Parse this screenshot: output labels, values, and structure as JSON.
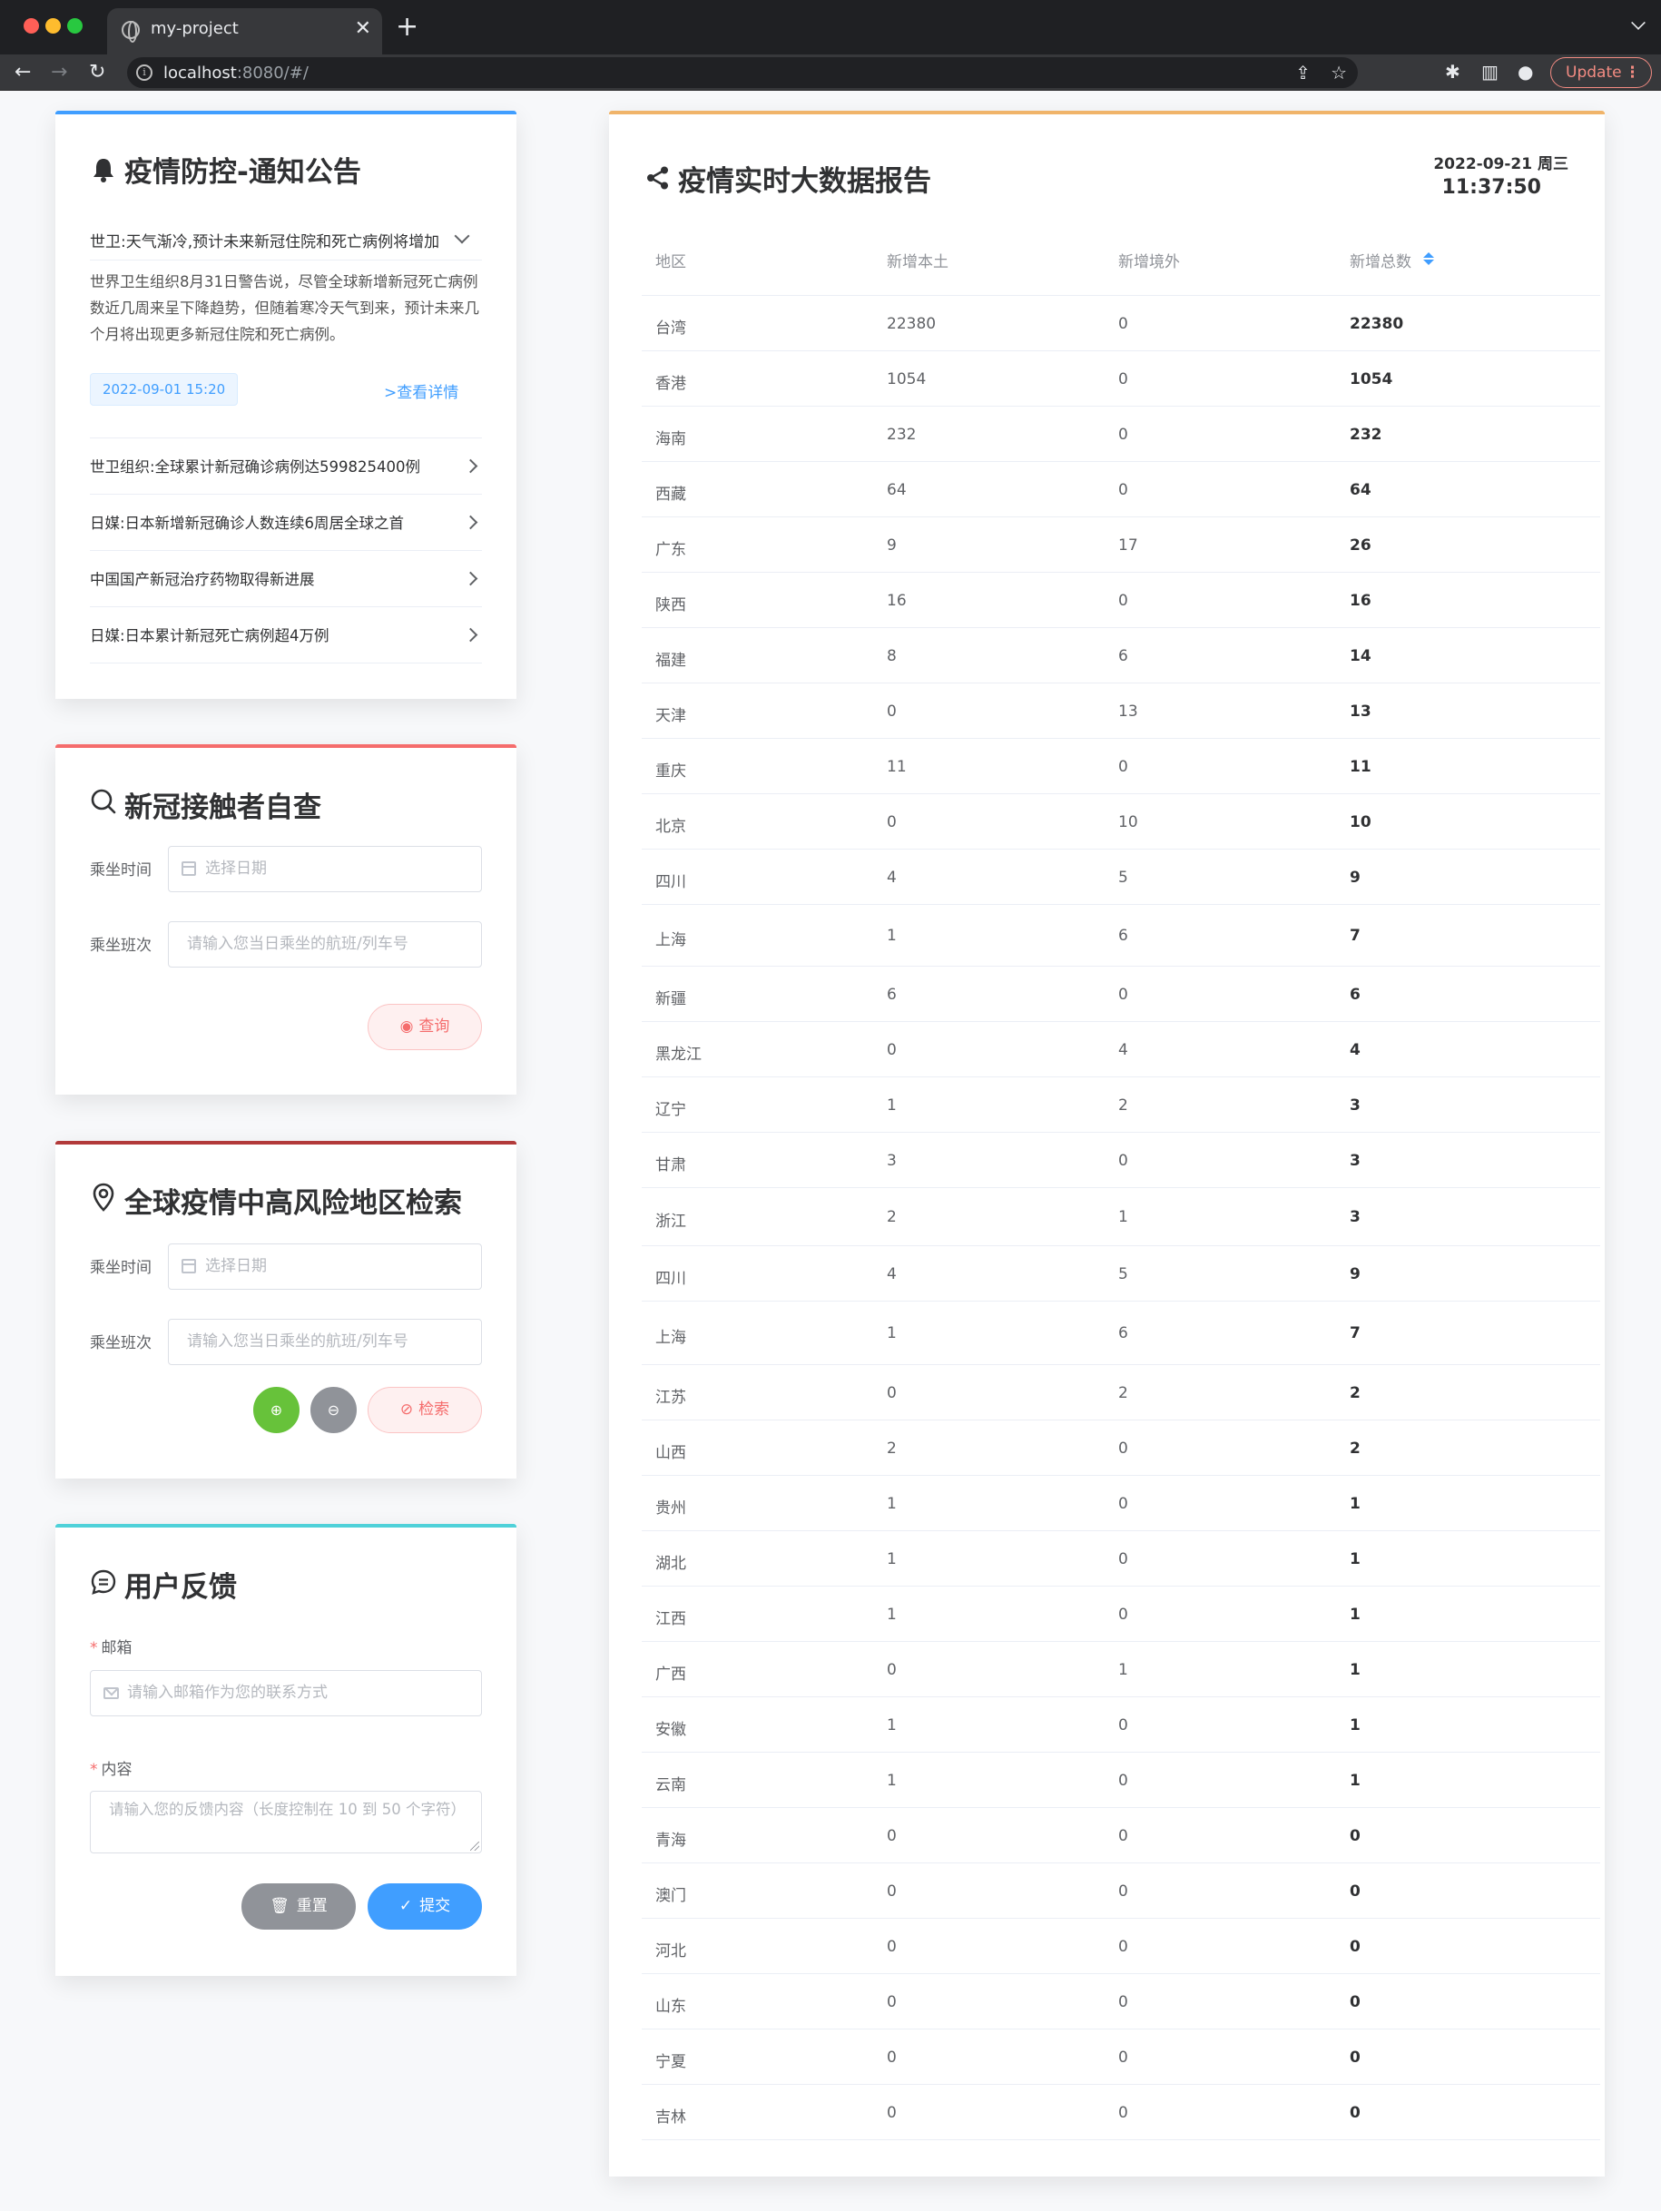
{
  "browser": {
    "tab_title": "my-project",
    "url_host": "localhost",
    "url_rest": ":8080/#/",
    "update_label": "Update"
  },
  "notice": {
    "title": "疫情防控-通知公告",
    "expanded": {
      "title": "世卫:天气渐冷,预计未来新冠住院和死亡病例将增加",
      "content": "世界卫生组织8月31日警告说，尽管全球新增新冠死亡病例数近几周来呈下降趋势，但随着寒冷天气到来，预计未来几个月将出现更多新冠住院和死亡病例。",
      "date": "2022-09-01 15:20",
      "detail_link": ">查看详情"
    },
    "items": [
      "世卫组织:全球累计新冠确诊病例达599825400例",
      "日媒:日本新增新冠确诊人数连续6周居全球之首",
      "中国国产新冠治疗药物取得新进展",
      "日媒:日本累计新冠死亡病例超4万例"
    ]
  },
  "contact_check": {
    "title": "新冠接触者自查",
    "time_label": "乘坐时间",
    "time_placeholder": "选择日期",
    "trip_label": "乘坐班次",
    "trip_placeholder": "请输入您当日乘坐的航班/列车号",
    "query_label": "查询"
  },
  "risk_search": {
    "title": "全球疫情中高风险地区检索",
    "time_label": "乘坐时间",
    "time_placeholder": "选择日期",
    "trip_label": "乘坐班次",
    "trip_placeholder": "请输入您当日乘坐的航班/列车号",
    "search_label": "检索"
  },
  "feedback": {
    "title": "用户反馈",
    "email_label": "邮箱",
    "email_placeholder": "请输入邮箱作为您的联系方式",
    "content_label": "内容",
    "content_placeholder": "请输入您的反馈内容（长度控制在 10 到 50 个字符）",
    "reset_label": "重置",
    "submit_label": "提交"
  },
  "report": {
    "title": "疫情实时大数据报告",
    "date": "2022-09-21 周三",
    "time": "11:37:50",
    "columns": [
      "地区",
      "新增本土",
      "新增境外",
      "新增总数"
    ],
    "rows": [
      [
        "台湾",
        "22380",
        "0",
        "22380"
      ],
      [
        "香港",
        "1054",
        "0",
        "1054"
      ],
      [
        "海南",
        "232",
        "0",
        "232"
      ],
      [
        "西藏",
        "64",
        "0",
        "64"
      ],
      [
        "广东",
        "9",
        "17",
        "26"
      ],
      [
        "陕西",
        "16",
        "0",
        "16"
      ],
      [
        "福建",
        "8",
        "6",
        "14"
      ],
      [
        "天津",
        "0",
        "13",
        "13"
      ],
      [
        "重庆",
        "11",
        "0",
        "11"
      ],
      [
        "北京",
        "0",
        "10",
        "10"
      ],
      [
        "四川",
        "4",
        "5",
        "9"
      ],
      [
        "上海",
        "1",
        "6",
        "7"
      ],
      [
        "新疆",
        "6",
        "0",
        "6"
      ],
      [
        "黑龙江",
        "0",
        "4",
        "4"
      ],
      [
        "辽宁",
        "1",
        "2",
        "3"
      ],
      [
        "甘肃",
        "3",
        "0",
        "3"
      ],
      [
        "浙江",
        "2",
        "1",
        "3"
      ],
      [
        "四川",
        "4",
        "5",
        "9"
      ],
      [
        "上海",
        "1",
        "6",
        "7"
      ],
      [
        "江苏",
        "0",
        "2",
        "2"
      ],
      [
        "山西",
        "2",
        "0",
        "2"
      ],
      [
        "贵州",
        "1",
        "0",
        "1"
      ],
      [
        "湖北",
        "1",
        "0",
        "1"
      ],
      [
        "江西",
        "1",
        "0",
        "1"
      ],
      [
        "广西",
        "0",
        "1",
        "1"
      ],
      [
        "安徽",
        "1",
        "0",
        "1"
      ],
      [
        "云南",
        "1",
        "0",
        "1"
      ],
      [
        "青海",
        "0",
        "0",
        "0"
      ],
      [
        "澳门",
        "0",
        "0",
        "0"
      ],
      [
        "河北",
        "0",
        "0",
        "0"
      ],
      [
        "山东",
        "0",
        "0",
        "0"
      ],
      [
        "宁夏",
        "0",
        "0",
        "0"
      ],
      [
        "吉林",
        "0",
        "0",
        "0"
      ]
    ]
  },
  "colors": {
    "notice_accent": "#409eff",
    "contact_accent": "#f56c6c",
    "risk_accent": "#b23a3a",
    "feedback_accent": "#4fd1d9",
    "report_accent": "#f0b46a"
  }
}
